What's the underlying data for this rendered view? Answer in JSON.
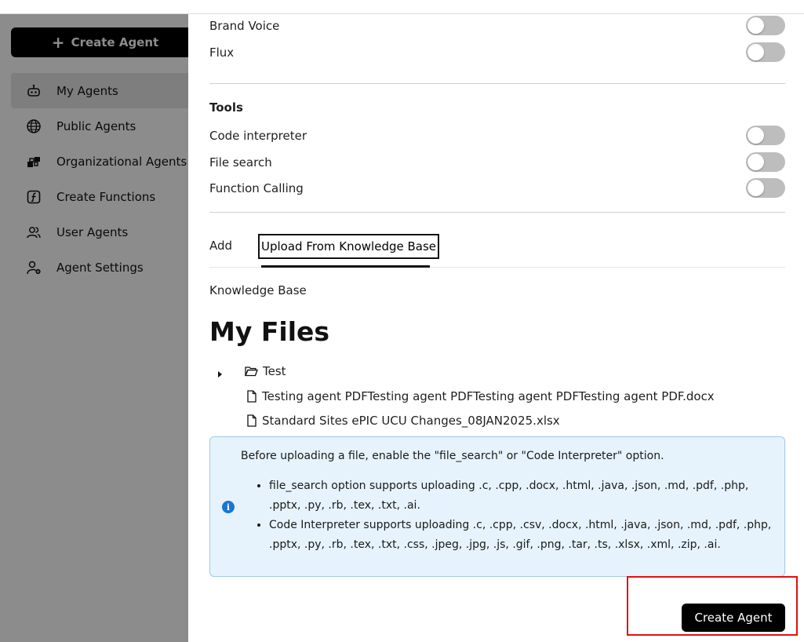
{
  "sidebar": {
    "create_label": "Create Agent",
    "items": [
      {
        "label": "My Agents",
        "icon": "robot-icon",
        "active": true
      },
      {
        "label": "Public Agents",
        "icon": "globe-icon",
        "active": false
      },
      {
        "label": "Organizational Agents",
        "icon": "blocks-icon",
        "active": false
      },
      {
        "label": "Create Functions",
        "icon": "function-icon",
        "active": false
      },
      {
        "label": "User Agents",
        "icon": "users-icon",
        "active": false
      },
      {
        "label": "Agent Settings",
        "icon": "user-gear-icon",
        "active": false
      }
    ]
  },
  "toggles_top": [
    {
      "label": "Brand Voice",
      "on": false
    },
    {
      "label": "Flux",
      "on": false
    }
  ],
  "tools": {
    "title": "Tools",
    "items": [
      {
        "label": "Code interpreter",
        "on": false
      },
      {
        "label": "File search",
        "on": false
      },
      {
        "label": "Function Calling",
        "on": false
      }
    ]
  },
  "tabs": {
    "add_label": "Add",
    "kb_label": "Upload From Knowledge Base"
  },
  "knowledge_base_label": "Knowledge Base",
  "files": {
    "title": "My Files",
    "folder": "Test",
    "items": [
      "Testing agent PDFTesting agent PDFTesting agent PDFTesting agent PDF.docx",
      "Standard Sites ePIC UCU Changes_08JAN2025.xlsx"
    ]
  },
  "info": {
    "intro": "Before uploading a file, enable the \"file_search\" or \"Code Interpreter\" option.",
    "bullets": [
      "file_search option supports uploading .c, .cpp, .docx, .html, .java, .json, .md, .pdf, .php, .pptx, .py, .rb, .tex, .txt, .ai.",
      "Code Interpreter supports uploading .c, .cpp, .csv, .docx, .html, .java, .json, .md, .pdf, .php, .pptx, .py, .rb, .tex, .txt, .css, .jpeg, .jpg, .js, .gif, .png, .tar, .ts, .xlsx, .xml, .zip, .ai."
    ]
  },
  "footer": {
    "create_agent_label": "Create Agent"
  },
  "colors": {
    "accent": "#000000",
    "info_bg": "#e6f3fc",
    "info_icon": "#1976d2",
    "highlight": "#e01010"
  }
}
